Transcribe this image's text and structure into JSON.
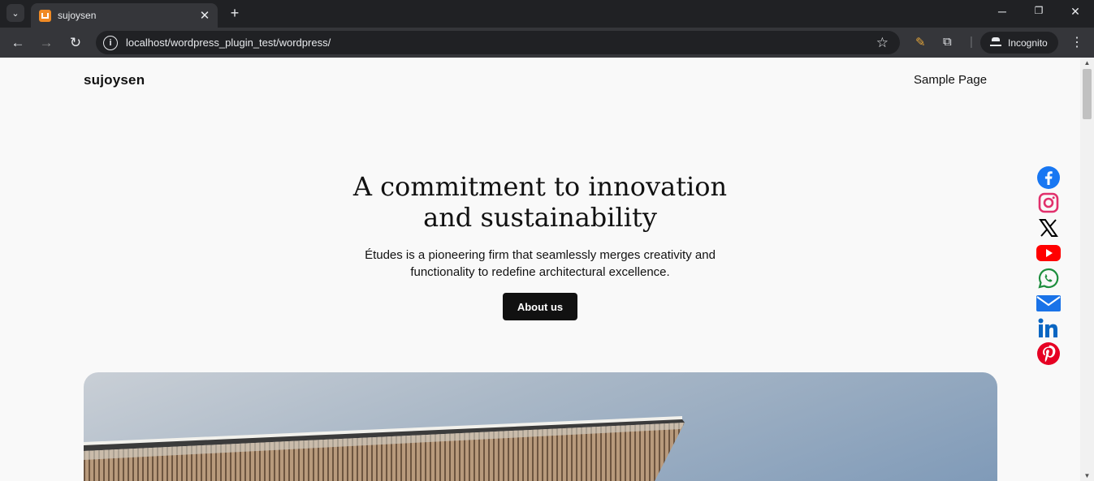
{
  "browser": {
    "tab_title": "sujoysen",
    "url": "localhost/wordpress_plugin_test/wordpress/",
    "incognito_label": "Incognito"
  },
  "site": {
    "title": "sujoysen",
    "nav": [
      "Sample Page"
    ]
  },
  "hero": {
    "title_line1": "A commitment to innovation",
    "title_line2": "and sustainability",
    "text_line1": "Études is a pioneering firm that seamlessly merges creativity and",
    "text_line2": "functionality to redefine architectural excellence.",
    "button": "About us"
  },
  "social_icons": [
    {
      "name": "facebook-icon",
      "color": "#1877f2"
    },
    {
      "name": "instagram-icon",
      "color": "#e1306c"
    },
    {
      "name": "x-icon",
      "color": "#000000"
    },
    {
      "name": "youtube-icon",
      "color": "#ff0000"
    },
    {
      "name": "whatsapp-icon",
      "color": "#25d366"
    },
    {
      "name": "email-icon",
      "color": "#1a73e8"
    },
    {
      "name": "linkedin-icon",
      "color": "#0a66c2"
    },
    {
      "name": "pinterest-icon",
      "color": "#e60023"
    }
  ]
}
